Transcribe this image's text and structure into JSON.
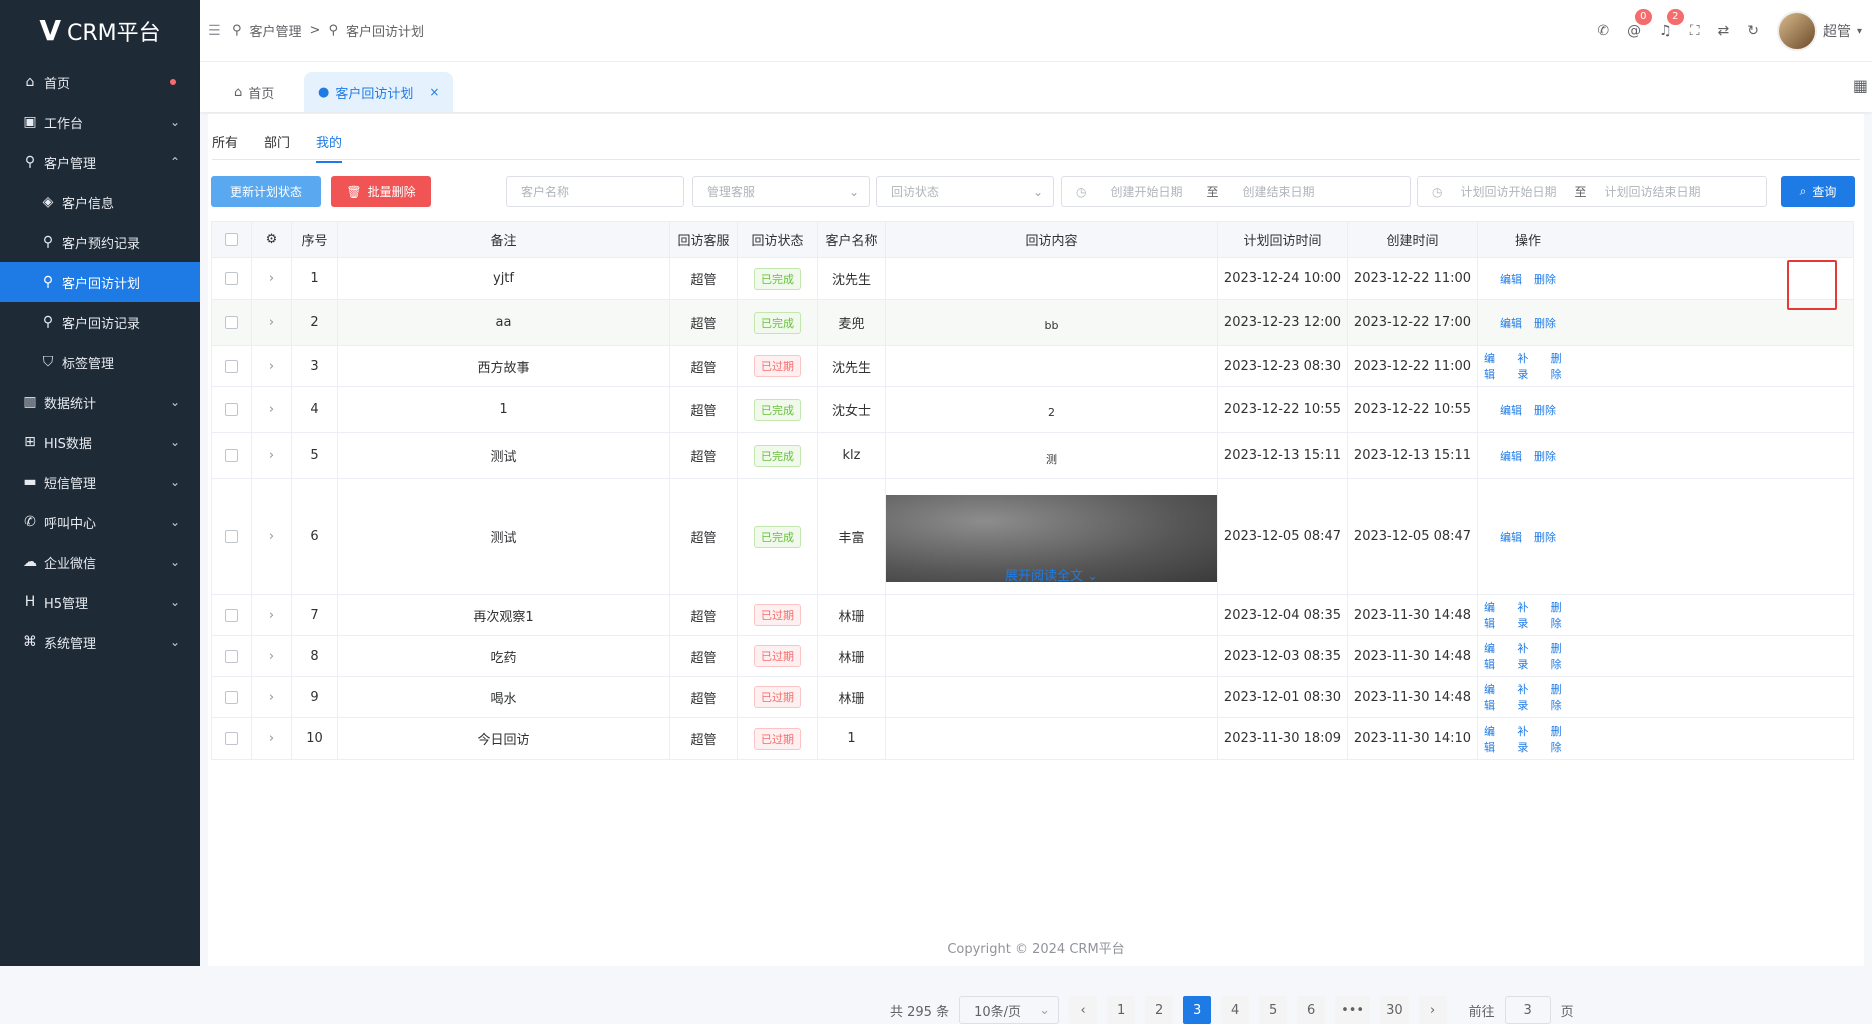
{
  "brand": {
    "logo_mark": "V",
    "name": "CRM平台"
  },
  "sidebar": {
    "items": [
      {
        "label": "首页",
        "icon": "home-icon",
        "type": "top",
        "dot": true
      },
      {
        "label": "工作台",
        "icon": "briefcase-icon",
        "type": "group"
      },
      {
        "label": "客户管理",
        "icon": "user-icon",
        "type": "group-open"
      },
      {
        "label": "客户信息",
        "icon": "id-icon",
        "type": "sub"
      },
      {
        "label": "客户预约记录",
        "icon": "user-icon",
        "type": "sub"
      },
      {
        "label": "客户回访计划",
        "icon": "user-icon",
        "type": "sub-active"
      },
      {
        "label": "客户回访记录",
        "icon": "user-icon",
        "type": "sub"
      },
      {
        "label": "标签管理",
        "icon": "shield-icon",
        "type": "sub"
      },
      {
        "label": "数据统计",
        "icon": "chart-icon",
        "type": "group"
      },
      {
        "label": "HIS数据",
        "icon": "his-icon",
        "type": "group"
      },
      {
        "label": "短信管理",
        "icon": "message-icon",
        "type": "group"
      },
      {
        "label": "呼叫中心",
        "icon": "phone-icon",
        "type": "group"
      },
      {
        "label": "企业微信",
        "icon": "wechat-icon",
        "type": "group"
      },
      {
        "label": "H5管理",
        "icon": "h5-icon",
        "type": "group"
      },
      {
        "label": "系统管理",
        "icon": "command-icon",
        "type": "group"
      }
    ]
  },
  "breadcrumb": {
    "level1": "客户管理",
    "sep": ">",
    "level2": "客户回访计划"
  },
  "topbar": {
    "mail_badge": "0",
    "bell_badge": "2",
    "username": "超管"
  },
  "tabs": {
    "home": "首页",
    "current": "客户回访计划",
    "close": "×"
  },
  "subtabs": [
    "所有",
    "部门",
    "我的"
  ],
  "toolbar": {
    "update_status": "更新计划状态",
    "batch_delete": "批量删除",
    "query": "查询"
  },
  "filters": {
    "customer_name": "客户名称",
    "manager": "管理客服",
    "status": "回访状态",
    "create_start": "创建开始日期",
    "create_end": "创建结束日期",
    "plan_start": "计划回访开始日期",
    "plan_end": "计划回访结束日期",
    "range_sep": "至"
  },
  "table": {
    "headers": [
      "序号",
      "备注",
      "回访客服",
      "回访状态",
      "客户名称",
      "回访内容",
      "计划回访时间",
      "创建时间",
      "操作"
    ],
    "rows": [
      {
        "no": "1",
        "remark": "yjtf",
        "agent": "超管",
        "status": "已完成",
        "kind": "ok",
        "customer": "沈先生",
        "content": "",
        "plan": "2023-12-24 10:00",
        "created": "2023-12-22 11:00",
        "ops": [
          "编辑",
          "删除"
        ]
      },
      {
        "no": "2",
        "remark": "aa",
        "agent": "超管",
        "status": "已完成",
        "kind": "ok",
        "customer": "麦兜",
        "content": "bb",
        "plan": "2023-12-23 12:00",
        "created": "2023-12-22 17:00",
        "ops": [
          "编辑",
          "删除"
        ]
      },
      {
        "no": "3",
        "remark": "西方故事",
        "agent": "超管",
        "status": "已过期",
        "kind": "exp",
        "customer": "沈先生",
        "content": "",
        "plan": "2023-12-23 08:30",
        "created": "2023-12-22 11:00",
        "ops": [
          "编辑",
          "补录",
          "删除"
        ]
      },
      {
        "no": "4",
        "remark": "1",
        "agent": "超管",
        "status": "已完成",
        "kind": "ok",
        "customer": "沈女士",
        "content": "2",
        "plan": "2023-12-22 10:55",
        "created": "2023-12-22 10:55",
        "ops": [
          "编辑",
          "删除"
        ]
      },
      {
        "no": "5",
        "remark": "测试",
        "agent": "超管",
        "status": "已完成",
        "kind": "ok",
        "customer": "klz",
        "content": "测",
        "plan": "2023-12-13 15:11",
        "created": "2023-12-13 15:11",
        "ops": [
          "编辑",
          "删除"
        ]
      },
      {
        "no": "6",
        "remark": "测试",
        "agent": "超管",
        "status": "已完成",
        "kind": "ok",
        "customer": "丰富",
        "content": "",
        "image": true,
        "readmore": "展开阅读全文",
        "plan": "2023-12-05 08:47",
        "created": "2023-12-05 08:47",
        "ops": [
          "编辑",
          "删除"
        ]
      },
      {
        "no": "7",
        "remark": "再次观察1",
        "agent": "超管",
        "status": "已过期",
        "kind": "exp",
        "customer": "林珊",
        "content": "",
        "plan": "2023-12-04 08:35",
        "created": "2023-11-30 14:48",
        "ops": [
          "编辑",
          "补录",
          "删除"
        ]
      },
      {
        "no": "8",
        "remark": "吃药",
        "agent": "超管",
        "status": "已过期",
        "kind": "exp",
        "customer": "林珊",
        "content": "",
        "plan": "2023-12-03 08:35",
        "created": "2023-11-30 14:48",
        "ops": [
          "编辑",
          "补录",
          "删除"
        ]
      },
      {
        "no": "9",
        "remark": "喝水",
        "agent": "超管",
        "status": "已过期",
        "kind": "exp",
        "customer": "林珊",
        "content": "",
        "plan": "2023-12-01 08:30",
        "created": "2023-11-30 14:48",
        "ops": [
          "编辑",
          "补录",
          "删除"
        ]
      },
      {
        "no": "10",
        "remark": "今日回访",
        "agent": "超管",
        "status": "已过期",
        "kind": "exp",
        "customer": "1",
        "content": "",
        "plan": "2023-11-30 18:09",
        "created": "2023-11-30 14:10",
        "ops": [
          "编辑",
          "补录",
          "删除"
        ]
      }
    ]
  },
  "pagination": {
    "total": "共 295 条",
    "page_size": "10条/页",
    "pages": [
      "1",
      "2",
      "3",
      "4",
      "5",
      "6",
      "•••",
      "30"
    ],
    "current": "3",
    "goto_label": "前往",
    "goto_value": "3",
    "page_unit": "页"
  },
  "footer": {
    "text": "Copyright © 2024 CRM平台"
  },
  "colors": {
    "primary": "#1e7be6",
    "danger": "#f56c6c",
    "sidebar": "#1f2a37"
  }
}
